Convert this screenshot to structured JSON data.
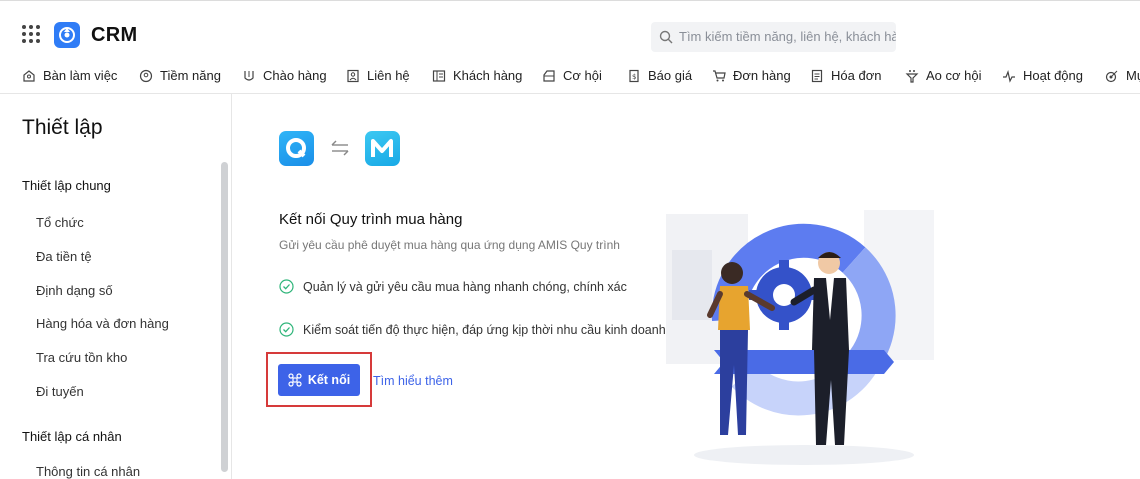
{
  "header": {
    "brand": "CRM",
    "search_placeholder": "Tìm kiếm tiềm năng, liên hệ, khách hàng"
  },
  "nav": {
    "items": [
      {
        "label": "Bàn làm việc",
        "icon": "desk-icon"
      },
      {
        "label": "Tiềm năng",
        "icon": "lead-icon"
      },
      {
        "label": "Chào hàng",
        "icon": "offer-icon"
      },
      {
        "label": "Liên hệ",
        "icon": "contact-icon"
      },
      {
        "label": "Khách hàng",
        "icon": "customer-icon"
      },
      {
        "label": "Cơ hội",
        "icon": "opportunity-icon"
      },
      {
        "label": "Báo giá",
        "icon": "quote-icon"
      },
      {
        "label": "Đơn hàng",
        "icon": "cart-icon"
      },
      {
        "label": "Hóa đơn",
        "icon": "invoice-icon"
      },
      {
        "label": "Ao cơ hội",
        "icon": "pool-icon"
      },
      {
        "label": "Hoạt động",
        "icon": "activity-icon"
      },
      {
        "label": "Mụ",
        "icon": "target-icon"
      }
    ]
  },
  "sidebar": {
    "title": "Thiết lập",
    "section_general": "Thiết lập chung",
    "general_items": [
      "Tổ chức",
      "Đa tiền tệ",
      "Định dạng số",
      "Hàng hóa và đơn hàng",
      "Tra cứu tồn kho",
      "Đi tuyến"
    ],
    "section_personal": "Thiết lập cá nhân",
    "personal_items": [
      "Thông tin cá nhân"
    ]
  },
  "main": {
    "title": "Kết nối Quy trình mua hàng",
    "subtitle": "Gửi yêu cầu phê duyệt mua hàng qua ứng dụng AMIS Quy trình",
    "features": [
      "Quản lý và gửi yêu cầu mua hàng nhanh chóng, chính xác",
      "Kiểm soát tiến độ thực hiện, đáp ứng kịp thời nhu cầu kinh doanh"
    ],
    "connect_button": "Kết nối",
    "learn_more": "Tìm hiểu thêm"
  },
  "colors": {
    "primary": "#3d63e8",
    "highlight": "#d63a3a",
    "check": "#2fb57a"
  }
}
